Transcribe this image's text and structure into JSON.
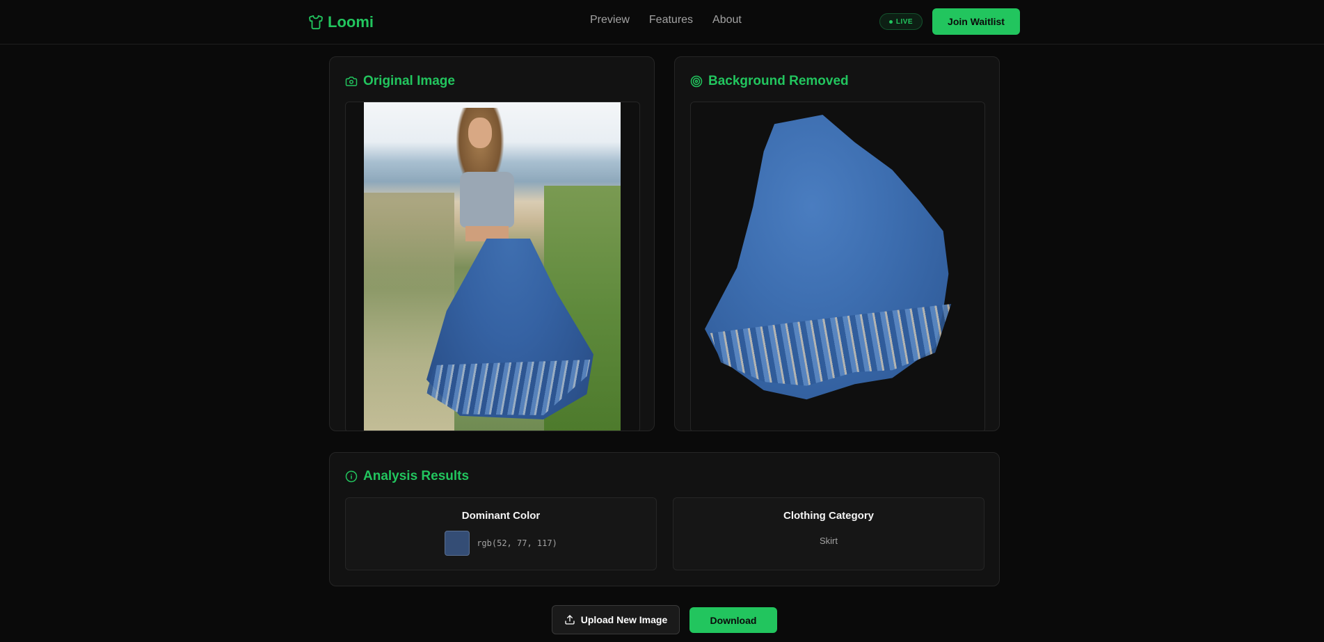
{
  "brand": {
    "name": "Loomi"
  },
  "nav": {
    "links": [
      "Preview",
      "Features",
      "About"
    ]
  },
  "header": {
    "live_badge": "LIVE",
    "waitlist_label": "Join Waitlist"
  },
  "original_panel": {
    "title": "Original Image",
    "icon": "camera-icon"
  },
  "removed_panel": {
    "title": "Background Removed",
    "icon": "target-icon"
  },
  "analysis": {
    "title": "Analysis Results",
    "icon": "info-icon",
    "dominant_color": {
      "label": "Dominant Color",
      "value": "rgb(52, 77, 117)",
      "swatch": "#344d75"
    },
    "category": {
      "label": "Clothing Category",
      "value": "Skirt"
    }
  },
  "actions": {
    "upload_label": "Upload New Image",
    "download_label": "Download"
  },
  "colors": {
    "accent": "#22c55e",
    "background": "#0a0a0a",
    "panel": "#121212"
  }
}
